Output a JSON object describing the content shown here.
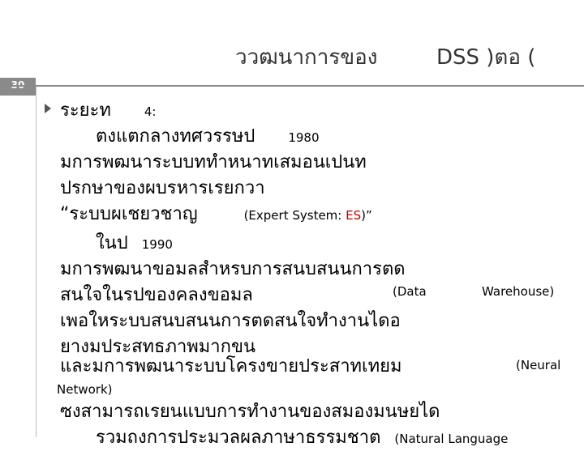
{
  "slide": {
    "title_left": "ววฒนาการของ",
    "title_right": "DSS )ตอ (",
    "page_number": "30"
  },
  "content": {
    "heading_text": "ระยะท",
    "heading_num": "4:",
    "l2_text": "ตงแตกลางทศวรรษป",
    "l2_year": "1980",
    "l3": "มการพฒนาระบบททำหนาทเสมอนเปนท",
    "l4": "ปรกษาของผบรหารเรยกวา",
    "l5_text": "“ระบบผเชยวชาญ",
    "l5_en_pre": "(Expert System:",
    "l5_en_accent": "ES",
    "l5_en_post": ")”",
    "l6_text": "ในป",
    "l6_year": "1990",
    "l7": "มการพฒนาขอมลสำหรบการสนบสนนการตด",
    "l8_text": "สนใจในรปของคลงขอมล",
    "l8_en1": "(Data",
    "l8_en2": "Warehouse)",
    "l9": "เพอใหระบบสนบสนนการตดสนใจทำงานไดอ",
    "l10": "ยางมประสทธภาพมากขน",
    "l11_text": "และมการพฒนาระบบโครงขายประสาทเทยม",
    "l11_en": "(Neural",
    "l12": "Network)",
    "l13": "ซงสามารถเรยนแบบการทำงานของสมองมนษยได",
    "l14_text": "รวมถงการประมวลผลภาษาธรรมชาต",
    "l14_en": "(Natural Language"
  }
}
